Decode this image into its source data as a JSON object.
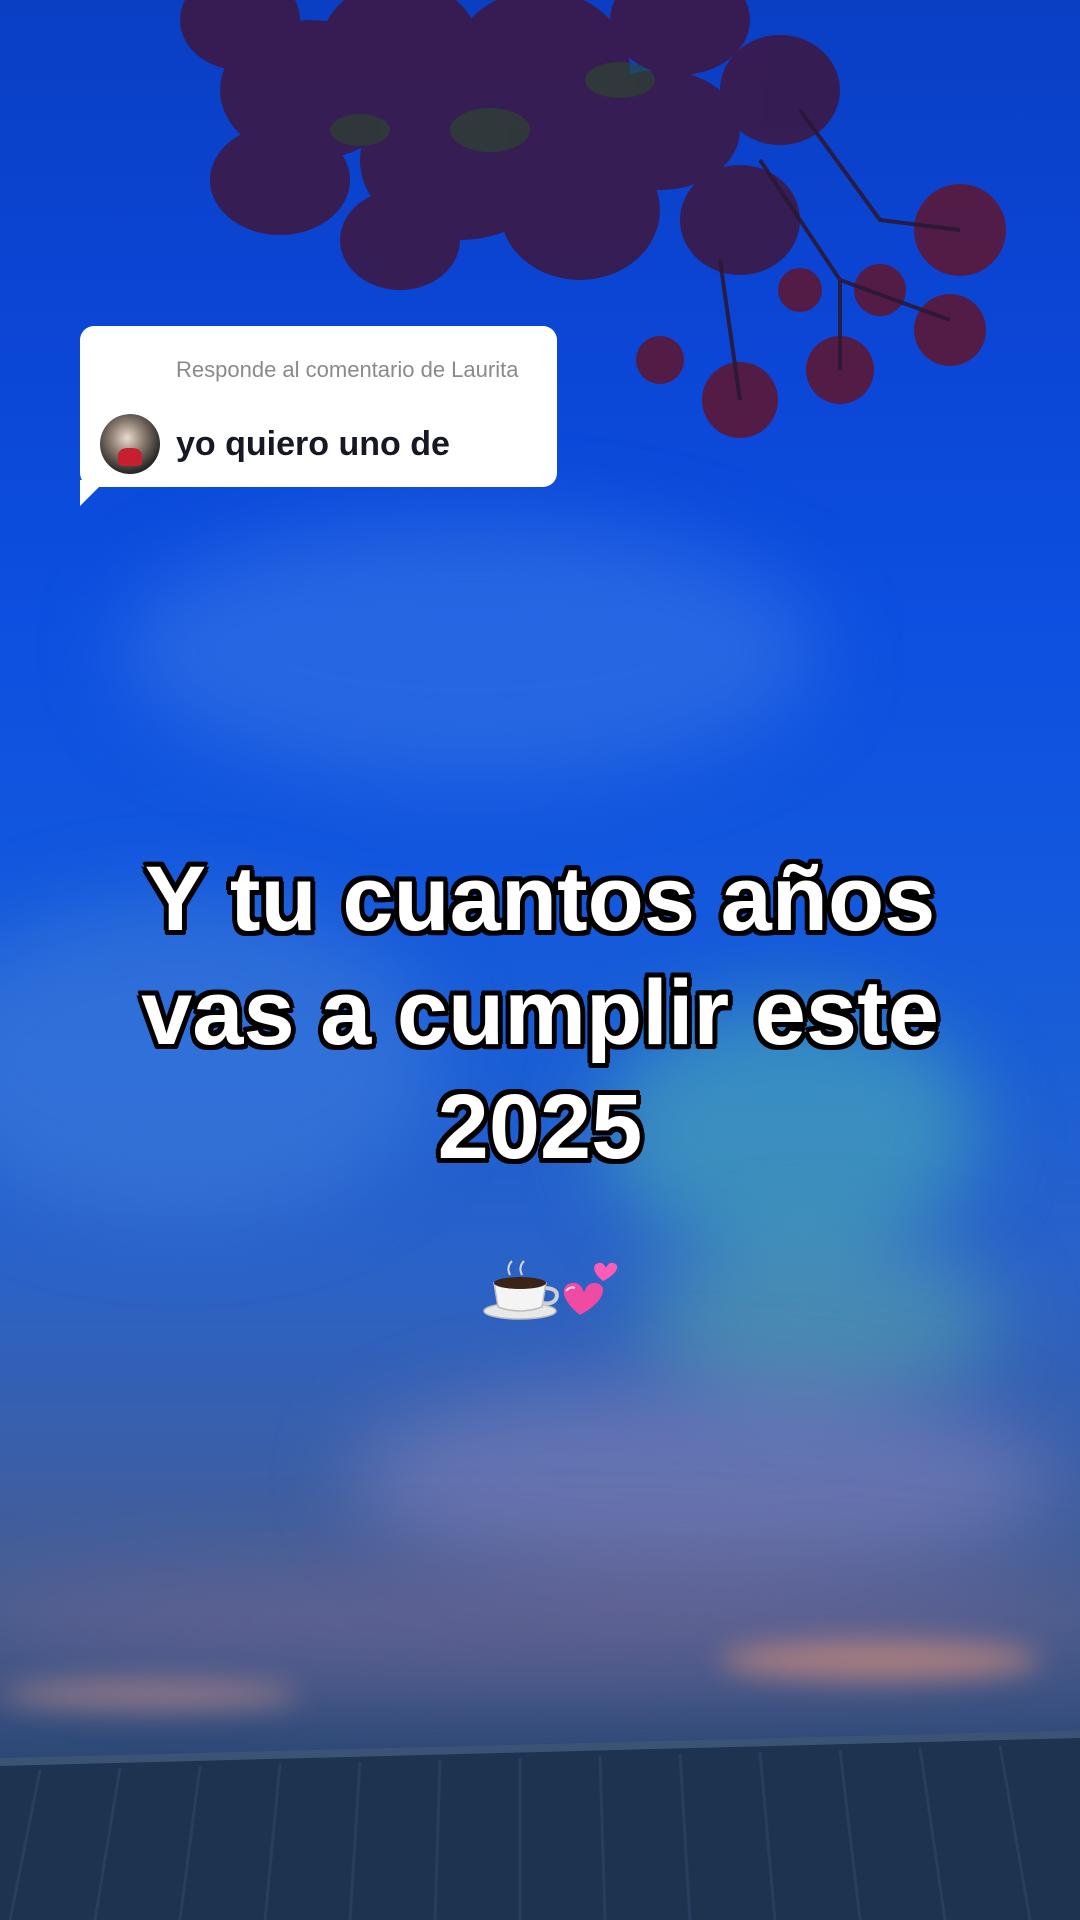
{
  "reply": {
    "header": "Responde al comentario de Laurita",
    "text": "yo quiero uno de"
  },
  "caption": {
    "line1": "Y tu cuantos años",
    "line2": "vas a cumplir este",
    "line3": "2025"
  },
  "emojis": {
    "coffee": "coffee-cup-icon",
    "hearts": "two-hearts-icon"
  },
  "colors": {
    "sky": "#0d4fe0",
    "bubble": "#ffffff",
    "reply_text": "#161823",
    "reply_header": "#8a8a8a",
    "caption_text": "#ffffff",
    "caption_outline": "#000000"
  }
}
